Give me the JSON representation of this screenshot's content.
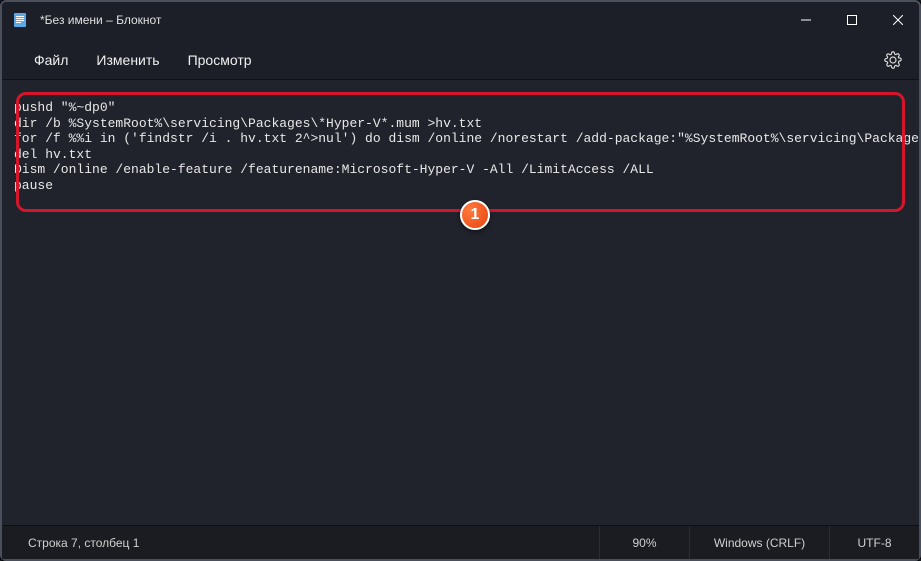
{
  "window": {
    "title": "*Без имени – Блокнот"
  },
  "menu": {
    "file": "Файл",
    "edit": "Изменить",
    "view": "Просмотр"
  },
  "code": {
    "line1": "pushd \"%~dp0\"",
    "line2": "dir /b %SystemRoot%\\servicing\\Packages\\*Hyper-V*.mum >hv.txt",
    "line3": "for /f %%i in ('findstr /i . hv.txt 2^>nul') do dism /online /norestart /add-package:\"%SystemRoot%\\servicing\\Packages\\%%i\"",
    "line4": "del hv.txt",
    "line5": "Dism /online /enable-feature /featurename:Microsoft-Hyper-V -All /LimitAccess /ALL",
    "line6": "pause"
  },
  "status": {
    "cursor": "Строка 7, столбец 1",
    "zoom": "90%",
    "lineEnding": "Windows (CRLF)",
    "encoding": "UTF-8"
  },
  "annotation": {
    "badge": "1"
  }
}
